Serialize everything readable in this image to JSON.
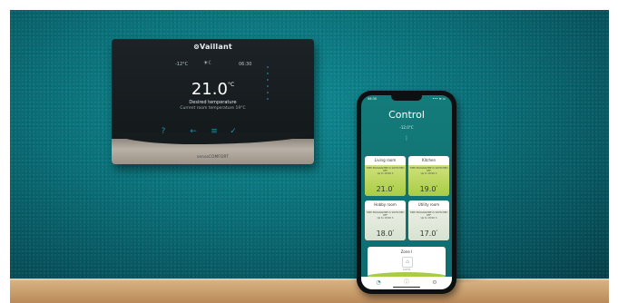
{
  "thermostat": {
    "brand": "⊚Vaillant",
    "outdoor_temp": "-12°C",
    "time": "06:30",
    "mode_icon": "sun-moon-icon",
    "temperature": "21.0",
    "temperature_unit": "°C",
    "label": "Desired temperature",
    "sublabel": "Current room temperature  19°C",
    "buttons": [
      "?",
      "←",
      "≡",
      "✓"
    ],
    "model": "sensoCOMFORT"
  },
  "phone": {
    "status_time": "06:30",
    "status_icons": "••• ≋ ▭",
    "title": "Control",
    "outdoor": "-12.0°C",
    "more": "⋮",
    "rooms": [
      {
        "name": "Living room",
        "status": "TIME PROGRAMME IS SWITCHED OFF",
        "until": "Up to 18:00 h",
        "temp": "21.0",
        "unit": "°",
        "state": "active"
      },
      {
        "name": "Kitchen",
        "status": "TIME PROGRAMME IS SWITCHED OFF",
        "until": "Up to 18:00 h",
        "temp": "19.0",
        "unit": "°",
        "state": "active"
      },
      {
        "name": "Hobby room",
        "status": "TIME PROGRAMME IS SWITCHED OFF",
        "until": "Up to 18:00 h",
        "temp": "18.0",
        "unit": "°",
        "state": "idle"
      },
      {
        "name": "Utility room",
        "status": "TIME PROGRAMME IS SWITCHED OFF",
        "until": "Up to 18:00 h",
        "temp": "17.0",
        "unit": "°",
        "state": "idle"
      }
    ],
    "zone": {
      "name": "Zone I",
      "mode": "AUTO"
    },
    "tabs": [
      {
        "icon": "thermostat-icon",
        "glyph": "◔"
      },
      {
        "icon": "info-icon",
        "glyph": "ⓘ"
      },
      {
        "icon": "settings-icon",
        "glyph": "⚙"
      }
    ]
  },
  "colors": {
    "wall": "#0a6f78",
    "accent_green": "#a9cc46",
    "app_teal": "#147b7a"
  }
}
